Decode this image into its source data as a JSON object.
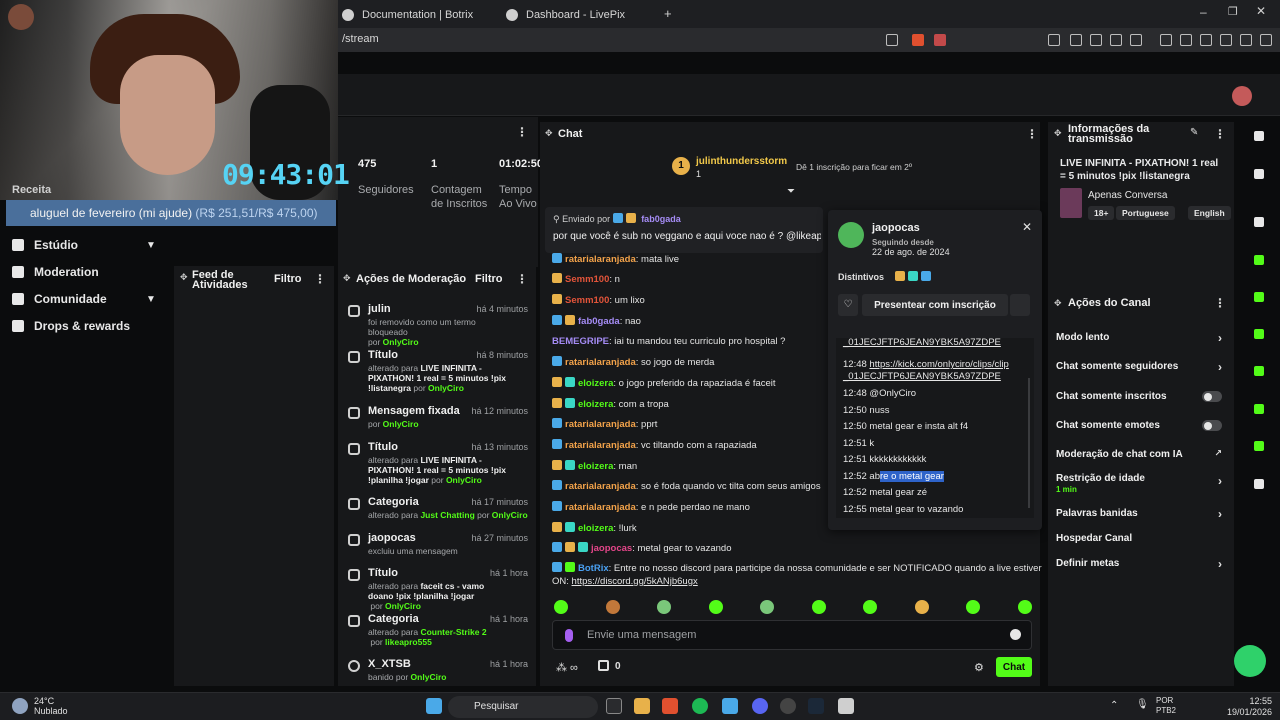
{
  "browser": {
    "tabs": [
      "Documentation | Botrix",
      "Dashboard - LivePix"
    ],
    "url_fragment": "/stream"
  },
  "overlay": {
    "clock": "09:43:01",
    "goal_prefix": "aluguel de fevereiro (mi ajude) ",
    "goal_amount": "(R$ 251,51/R$ 475,00)",
    "receipt_label": "Receita"
  },
  "sidebar": {
    "items": [
      {
        "label": "Estúdio",
        "chevron": true
      },
      {
        "label": "Moderation",
        "chevron": false
      },
      {
        "label": "Comunidade",
        "chevron": true
      },
      {
        "label": "Drops & rewards",
        "chevron": false
      }
    ]
  },
  "stats": {
    "followers_value": "475",
    "followers_label": "Seguidores",
    "subs_value": "1",
    "subs_label": "Contagem de Inscritos",
    "time_value": "01:02:50",
    "time_label": "Tempo Ao Vivo"
  },
  "feed": {
    "title": "Feed de Atividades",
    "filter": "Filtro"
  },
  "modlog": {
    "title": "Ações de Moderação",
    "filter": "Filtro",
    "entries": [
      {
        "title": "julin",
        "time": "há 4 minutos",
        "desc": "foi removido como um termo bloqueado",
        "by_prefix": "por ",
        "by": "OnlyCiro"
      },
      {
        "title": "Título",
        "time": "há 8 minutos",
        "desc_prefix": "alterado para ",
        "value": "LIVE INFINITA - PIXATHON! 1 real = 5 minutos !pix !listanegra",
        "by_prefix": " por ",
        "by": "OnlyCiro"
      },
      {
        "title": "Mensagem fixada",
        "time": "há 12 minutos",
        "by_prefix": "por ",
        "by": "OnlyCiro"
      },
      {
        "title": "Título",
        "time": "há 13 minutos",
        "desc_prefix": "alterado para ",
        "value": "LIVE INFINITA - PIXATHON! 1 real = 5 minutos !pix !planilha !jogar",
        "by_prefix": " por ",
        "by": "OnlyCiro"
      },
      {
        "title": "Categoria",
        "time": "há 17 minutos",
        "desc_prefix": "alterado para ",
        "value": "Just Chatting",
        "by_prefix": " por ",
        "by": "OnlyCiro"
      },
      {
        "title": "jaopocas",
        "time": "há 27 minutos",
        "desc": "excluiu uma mensagem"
      },
      {
        "title": "Título",
        "time": "há 1 hora",
        "desc_prefix": "alterado para ",
        "value": "faceit cs - vamo doano !pix !planilha !jogar",
        "by_prefix": " por ",
        "by": "OnlyCiro"
      },
      {
        "title": "Categoria",
        "time": "há 1 hora",
        "desc_prefix": "alterado para ",
        "value": "Counter-Strike 2",
        "by_prefix": " por ",
        "by": "likeapro555"
      },
      {
        "title": "X_XTSB",
        "time": "há 1 hora",
        "desc": "banido por ",
        "by": "OnlyCiro"
      }
    ]
  },
  "chat": {
    "title": "Chat",
    "top_user": "julinthundersstorm",
    "top_user_count": "1",
    "top_hint": "Dê 1 inscrição para ficar em 2º",
    "pinned_by_label": "Enviado por",
    "pinned_user": "fab0gada",
    "pinned_text": "por que você é sub no veggano e aqui voce nao é ? @likeap",
    "messages": [
      {
        "user": "ratarialaranjada",
        "color": "u-orange",
        "badges": [
          "b-blue"
        ],
        "text": "mata live"
      },
      {
        "user": "Semm100",
        "color": "u-red",
        "badges": [
          "b-gold"
        ],
        "text": "n"
      },
      {
        "user": "Semm100",
        "color": "u-red",
        "badges": [
          "b-gold"
        ],
        "text": "um lixo"
      },
      {
        "user": "fab0gada",
        "color": "u-purple",
        "badges": [
          "b-blue",
          "b-gold"
        ],
        "text": "nao"
      },
      {
        "user": "BEMEGRIPE",
        "color": "u-purple",
        "badges": [],
        "text": "iai tu mandou teu curriculo pro hospital ?"
      },
      {
        "user": "ratarialaranjada",
        "color": "u-orange",
        "badges": [
          "b-blue"
        ],
        "text": "so jogo de merda"
      },
      {
        "user": "eloizera",
        "color": "u-green",
        "badges": [
          "b-gold",
          "b-teal"
        ],
        "text": "o jogo preferido da rapaziada é faceit"
      },
      {
        "user": "eloizera",
        "color": "u-green",
        "badges": [
          "b-gold",
          "b-teal"
        ],
        "text": "com a tropa"
      },
      {
        "user": "ratarialaranjada",
        "color": "u-orange",
        "badges": [
          "b-blue"
        ],
        "text": "pprt"
      },
      {
        "user": "ratarialaranjada",
        "color": "u-orange",
        "badges": [
          "b-blue"
        ],
        "text": "vc tiltando com a rapaziada"
      },
      {
        "user": "eloizera",
        "color": "u-green",
        "badges": [
          "b-gold",
          "b-teal"
        ],
        "text": "man"
      },
      {
        "user": "ratarialaranjada",
        "color": "u-orange",
        "badges": [
          "b-blue"
        ],
        "text": "so é foda quando vc tilta com seus amigos"
      },
      {
        "user": "ratarialaranjada",
        "color": "u-orange",
        "badges": [
          "b-blue"
        ],
        "text": "e n pede perdao ne mano"
      },
      {
        "user": "eloizera",
        "color": "u-green",
        "badges": [
          "b-gold",
          "b-teal"
        ],
        "text": "!lurk"
      },
      {
        "user": "jaopocas",
        "color": "u-magenta",
        "badges": [
          "b-blue",
          "b-gold",
          "b-teal"
        ],
        "text": "metal gear to vazando"
      }
    ],
    "bot_user": "BotRix",
    "bot_text": "Entre no nosso discord para participe da nossa comunidade e ser NOTIFICADO quando a live estiver",
    "bot_text2": "ON: ",
    "bot_link": "https://discord.gg/5kANjb6ugx",
    "input_placeholder": "Envie uma mensagem",
    "chat_button": "Chat",
    "points_value": "0"
  },
  "usercard": {
    "name": "jaopocas",
    "following_since_label": "Seguindo desde",
    "following_since": "22 de ago. de 2024",
    "badges_label": "Distintivos",
    "gift_label": "Presentear com inscrição",
    "messages": [
      {
        "time": "",
        "text": "_01JECJFTP6JEAN9YBK5A97ZDPE",
        "link": true
      },
      {
        "time": "12:48",
        "text": "https://kick.com/onlyciro/clips/clip",
        "link": true
      },
      {
        "time": "",
        "text": "_01JECJFTP6JEAN9YBK5A97ZDPE",
        "link": true
      },
      {
        "time": "12:48",
        "text": "@OnlyCiro"
      },
      {
        "time": "12:50",
        "text": "nuss"
      },
      {
        "time": "12:50",
        "text": "metal gear e insta alt f4"
      },
      {
        "time": "12:51",
        "text": "k"
      },
      {
        "time": "12:51",
        "text": "kkkkkkkkkkkk"
      },
      {
        "time": "12:52",
        "text_pre": "ab",
        "text_sel": "re o metal gear"
      },
      {
        "time": "12:52",
        "text": "metal gear zé"
      },
      {
        "time": "12:55",
        "text": "metal gear to vazando"
      }
    ]
  },
  "info": {
    "title": "Informações da transmissão",
    "stream_title": "LIVE INFINITA - PIXATHON! 1 real = 5 minutos !pix !listanegra",
    "category": "Apenas Conversa",
    "tags": [
      "18+",
      "Portuguese",
      "English"
    ]
  },
  "channel_actions": {
    "title": "Ações do Canal",
    "items": [
      {
        "label": "Modo lento",
        "control": "chevron"
      },
      {
        "label": "Chat somente seguidores",
        "control": "chevron"
      },
      {
        "label": "Chat somente inscritos",
        "control": "toggle"
      },
      {
        "label": "Chat somente emotes",
        "control": "toggle"
      },
      {
        "label": "Moderação de chat com IA",
        "control": "external"
      },
      {
        "label": "Restrição de idade",
        "sub": "1 min",
        "control": "chevron"
      },
      {
        "label": "Palavras banidas",
        "control": "chevron"
      },
      {
        "label": "Hospedar Canal",
        "control": "none"
      },
      {
        "label": "Definir metas",
        "control": "chevron"
      }
    ]
  },
  "taskbar": {
    "temp": "24°C",
    "weather": "Nublado",
    "search": "Pesquisar",
    "lang1": "POR",
    "lang2": "PTB2",
    "time": "12:55",
    "date": "19/01/2026"
  },
  "colors": {
    "accent": "#53fc18",
    "panel": "#17181a",
    "background": "#0b0c0d"
  }
}
